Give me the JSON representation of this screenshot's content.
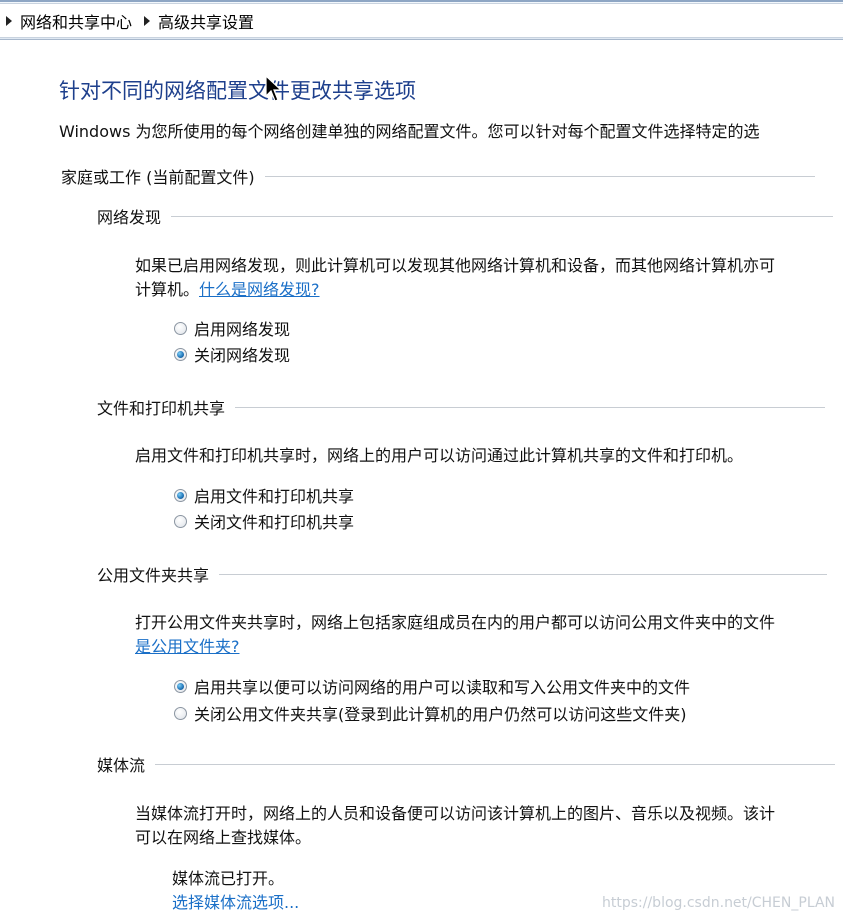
{
  "breadcrumb": {
    "items": [
      {
        "label": "网络和共享中心"
      },
      {
        "label": "高级共享设置"
      }
    ]
  },
  "page": {
    "title": "针对不同的网络配置文件更改共享选项",
    "intro": "Windows 为您所使用的每个网络创建单独的网络配置文件。您可以针对每个配置文件选择特定的选"
  },
  "profile": {
    "label": "家庭或工作 (当前配置文件)"
  },
  "sections": {
    "network_discovery": {
      "title": "网络发现",
      "desc_line1": "如果已启用网络发现，则此计算机可以发现其他网络计算机和设备，而其他网络计算机亦可",
      "desc_line2_prefix": "计算机。",
      "link": "什么是网络发现?",
      "options": [
        {
          "label": "启用网络发现",
          "checked": false
        },
        {
          "label": "关闭网络发现",
          "checked": true
        }
      ]
    },
    "file_printer_sharing": {
      "title": "文件和打印机共享",
      "desc": "启用文件和打印机共享时，网络上的用户可以访问通过此计算机共享的文件和打印机。",
      "options": [
        {
          "label": "启用文件和打印机共享",
          "checked": true
        },
        {
          "label": "关闭文件和打印机共享",
          "checked": false
        }
      ]
    },
    "public_folder_sharing": {
      "title": "公用文件夹共享",
      "desc_line1": "打开公用文件夹共享时，网络上包括家庭组成员在内的用户都可以访问公用文件夹中的文件",
      "link": "是公用文件夹?",
      "options": [
        {
          "label": "启用共享以便可以访问网络的用户可以读取和写入公用文件夹中的文件",
          "checked": true
        },
        {
          "label": "关闭公用文件夹共享(登录到此计算机的用户仍然可以访问这些文件夹)",
          "checked": false
        }
      ]
    },
    "media_streaming": {
      "title": "媒体流",
      "desc_line1": "当媒体流打开时，网络上的人员和设备便可以访问该计算机上的图片、音乐以及视频。该计",
      "desc_line2": "可以在网络上查找媒体。",
      "status": "媒体流已打开。",
      "link": "选择媒体流选项..."
    }
  },
  "watermark": "https://blog.csdn.net/CHEN_PLAN",
  "colors": {
    "title": "#1d3f8c",
    "link": "#1a6fc7",
    "rule": "#c8cdd3"
  }
}
